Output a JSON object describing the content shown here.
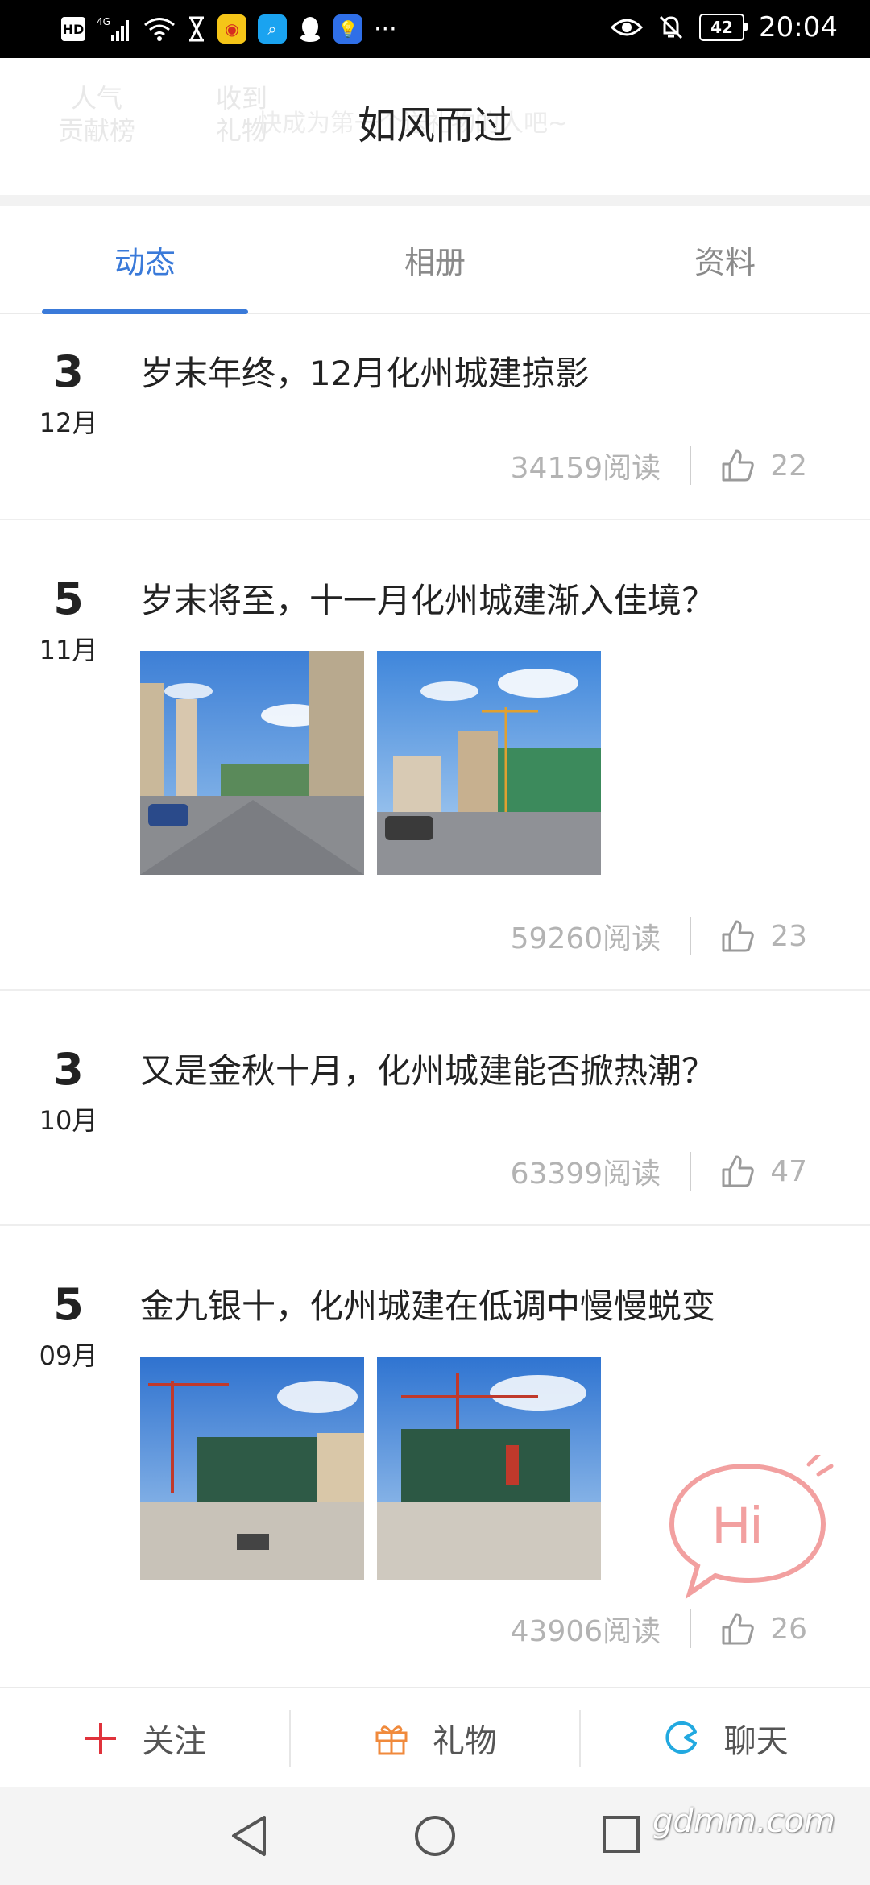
{
  "status_bar": {
    "left_icons": [
      "hd-icon",
      "signal-4g-icon",
      "wifi-icon",
      "hourglass-icon",
      "weibo-icon",
      "search-app-icon",
      "qq-icon",
      "bulb-app-icon",
      "more-dots-icon"
    ],
    "battery": "42",
    "time": "20:04"
  },
  "header": {
    "ghost_left_1": "人气\n贡献榜",
    "ghost_left_2": "收到\n礼物",
    "ghost_hint": "快成为第一个送礼物的人吧~",
    "title": "如风而过"
  },
  "tabs": [
    {
      "label": "动态",
      "active": true
    },
    {
      "label": "相册",
      "active": false
    },
    {
      "label": "资料",
      "active": false
    }
  ],
  "posts": [
    {
      "day": "3",
      "month": "12月",
      "title": "岁末年终，12月化州城建掠影",
      "reads": "34159阅读",
      "likes": "22",
      "images": []
    },
    {
      "day": "5",
      "month": "11月",
      "title": "岁末将至，十一月化州城建渐入佳境？",
      "reads": "59260阅读",
      "likes": "23",
      "images": [
        "street-photo",
        "plaza-photo"
      ]
    },
    {
      "day": "3",
      "month": "10月",
      "title": "又是金秋十月，化州城建能否掀热潮？",
      "reads": "63399阅读",
      "likes": "47",
      "images": []
    },
    {
      "day": "5",
      "month": "09月",
      "title": "金九银十，化州城建在低调中慢慢蜕变",
      "reads": "43906阅读",
      "likes": "26",
      "images": [
        "construction-photo-1",
        "construction-photo-2"
      ]
    }
  ],
  "hi_bubble": "Hi",
  "bottom_bar": {
    "follow": "关注",
    "gift": "礼物",
    "chat": "聊天"
  },
  "watermark": "gdmm.com",
  "colors": {
    "accent": "#3a7ad9",
    "follow_icon": "#e0323b",
    "gift_icon": "#f08a3c",
    "chat_icon": "#22a9e0",
    "hi_bubble": "#f2a0a0"
  }
}
